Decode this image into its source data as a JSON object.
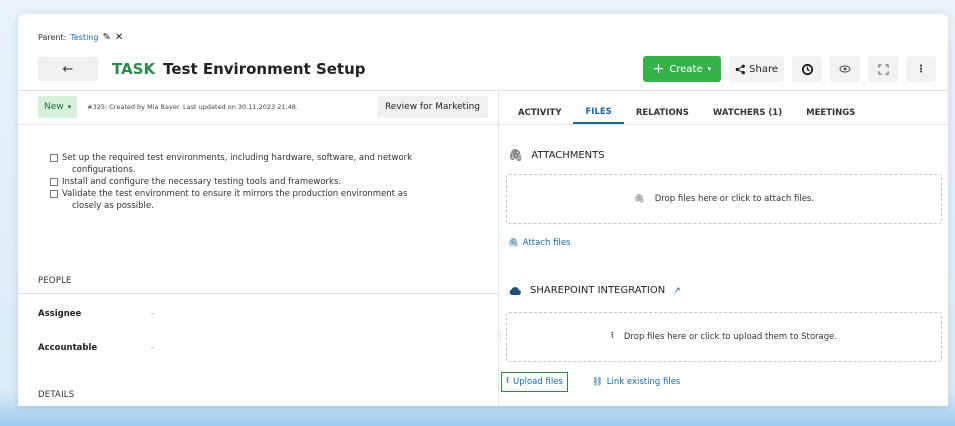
{
  "header": {
    "parent_label": "Parent:",
    "parent_link": "Testing",
    "type": "TASK",
    "title": "Test Environment Setup",
    "back_glyph": "←",
    "pencil_glyph": "✎",
    "close_glyph": "✕"
  },
  "toolbar": {
    "create_label": "Create",
    "share_label": "Share",
    "accent": "#35b24a"
  },
  "status": {
    "value": "New",
    "meta": "#325: Created by Mia Bayer. Last updated on 30.11.2023 21:48.",
    "review_label": "Review for Marketing"
  },
  "description": {
    "items": [
      {
        "text": "Set up the required test environments, including hardware, software, and network",
        "continuation": "configurations."
      },
      {
        "text": "Install and configure the necessary testing tools and frameworks.",
        "continuation": ""
      },
      {
        "text": "Validate the test environment to ensure it mirrors the production environment as",
        "continuation": "closely as possible."
      }
    ]
  },
  "people": {
    "section": "PEOPLE",
    "assignee_label": "Assignee",
    "assignee_value": "-",
    "accountable_label": "Accountable",
    "accountable_value": "-"
  },
  "details": {
    "section": "DETAILS"
  },
  "tabs": [
    {
      "label": "ACTIVITY"
    },
    {
      "label": "FILES"
    },
    {
      "label": "RELATIONS"
    },
    {
      "label": "WATCHERS (1)"
    },
    {
      "label": "MEETINGS"
    }
  ],
  "attachments": {
    "title": "ATTACHMENTS",
    "drop_text": "Drop files here or click to attach files.",
    "attach_link": "Attach files"
  },
  "sharepoint": {
    "title": "SHAREPOINT INTEGRATION",
    "drop_text": "Drop files here or click to upload them to Storage.",
    "upload_label": "Upload files",
    "link_label": "Link existing files"
  }
}
